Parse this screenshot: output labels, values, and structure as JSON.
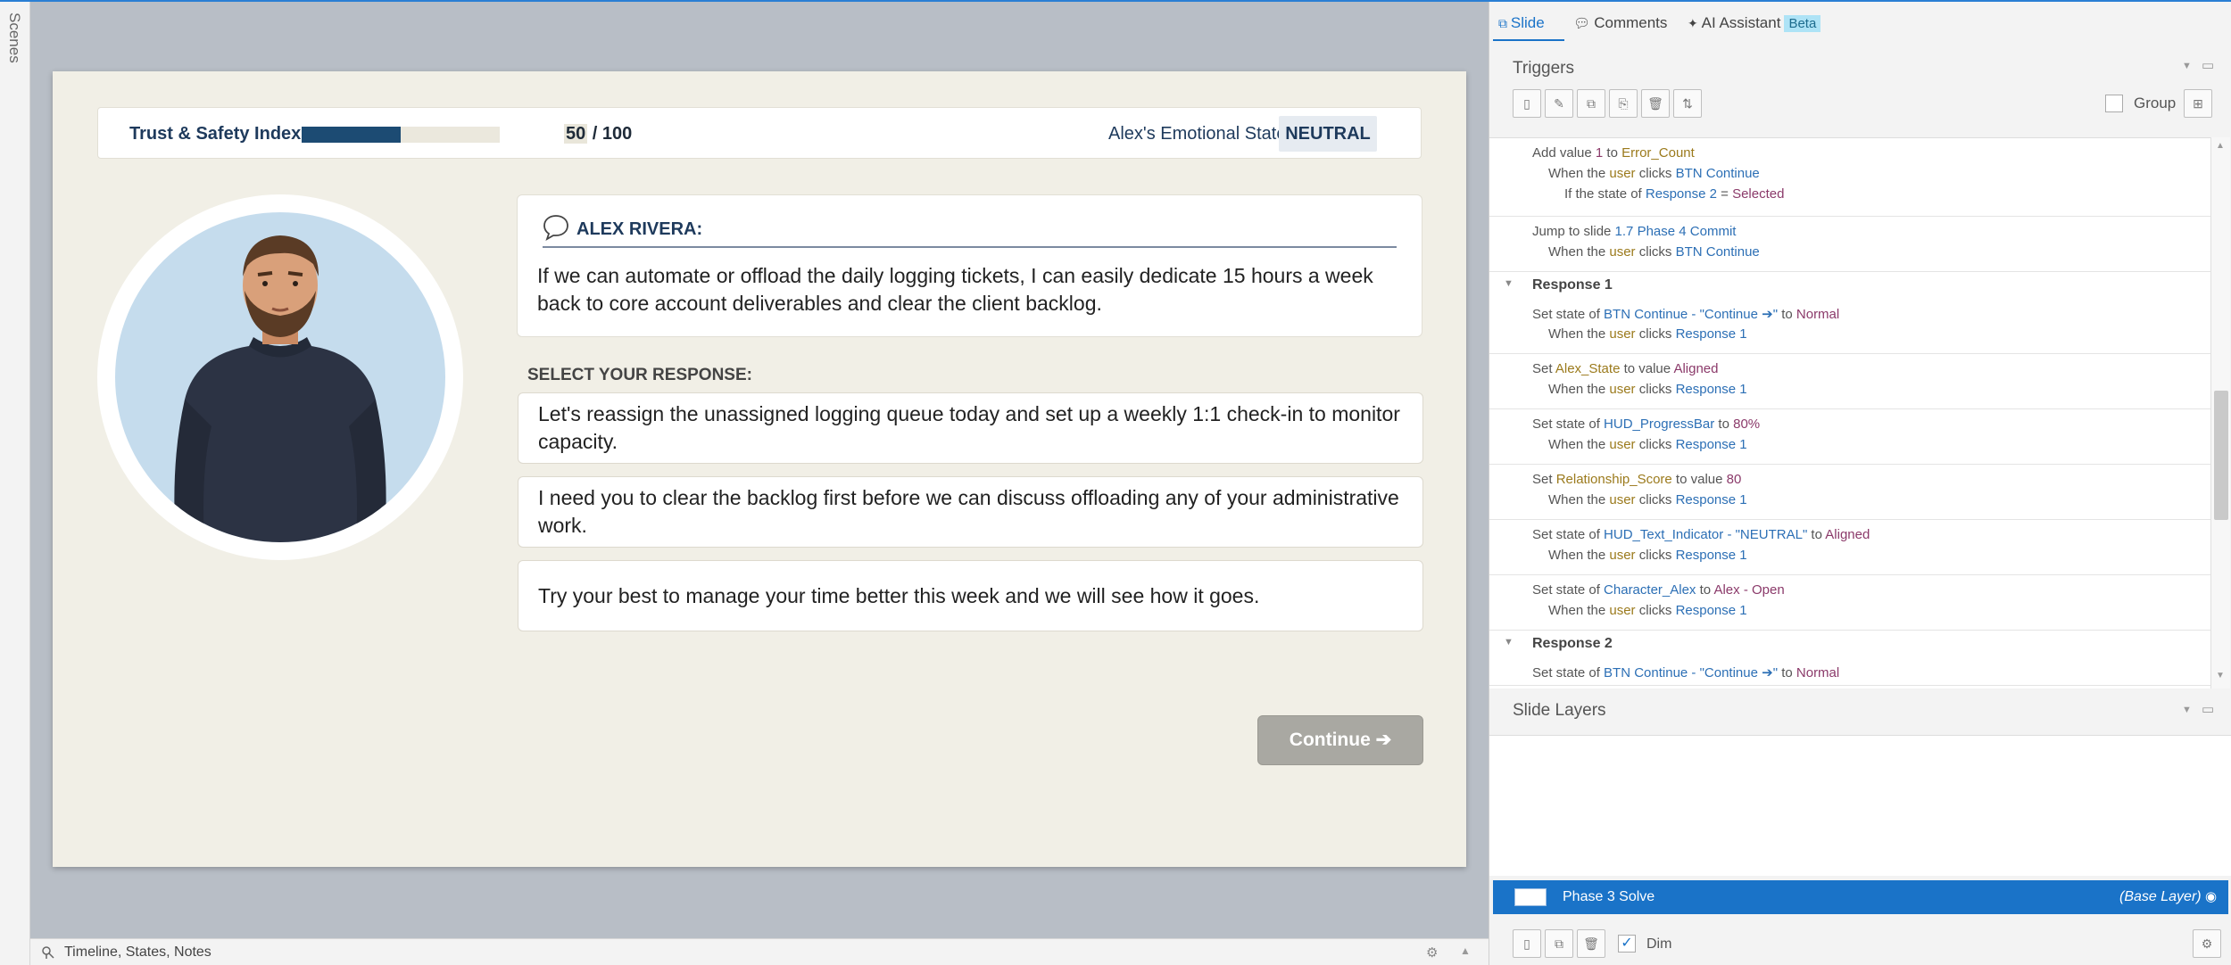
{
  "left_strip": {
    "label": "Scenes"
  },
  "hud": {
    "trust_label": "Trust & Safety Index:",
    "trust_progress_percent": 50,
    "score_value": "50",
    "score_suffix": " / 100",
    "emotion_label": "Alex's Emotional State:",
    "emotion_value": "NEUTRAL"
  },
  "speech": {
    "name": "ALEX RIVERA:",
    "text": "If we can automate or offload the daily logging tickets, I can easily dedicate 15 hours a week back to core account deliverables and clear the client backlog."
  },
  "select_label": "SELECT YOUR RESPONSE:",
  "responses": [
    "Let's reassign the unassigned logging queue today and set up a weekly 1:1 check-in to monitor capacity.",
    "I need you to clear the backlog first before we can discuss offloading any of your administrative work.",
    "Try your best to manage your time better this week and we will see how it goes."
  ],
  "continue_label": "Continue ➔",
  "bottom_bar": {
    "label": "Timeline, States, Notes"
  },
  "tabs": {
    "slide": "Slide",
    "comments": "Comments",
    "ai": "AI Assistant",
    "beta": "Beta"
  },
  "triggers_panel": {
    "title": "Triggers",
    "group_label": "Group",
    "rows": [
      {
        "parts": [
          [
            "Add value ",
            ""
          ],
          [
            "1",
            "p"
          ],
          [
            " to ",
            ""
          ],
          [
            "Error_Count",
            "v"
          ]
        ],
        "when": [
          [
            "When the ",
            ""
          ],
          [
            "user",
            "v"
          ],
          [
            " clicks ",
            ""
          ],
          [
            "BTN Continue",
            "u"
          ]
        ],
        "cond": [
          [
            "If the state of ",
            ""
          ],
          [
            "Response 2",
            "u"
          ],
          [
            " = ",
            ""
          ],
          [
            "Selected",
            "p"
          ]
        ]
      },
      {
        "parts": [
          [
            "Jump to slide ",
            ""
          ],
          [
            "1.7 Phase 4 Commit",
            "u"
          ]
        ],
        "when": [
          [
            "When the ",
            ""
          ],
          [
            "user",
            "v"
          ],
          [
            " clicks ",
            ""
          ],
          [
            "BTN Continue",
            "u"
          ]
        ]
      }
    ],
    "group1": "Response 1",
    "group1_rows": [
      {
        "parts": [
          [
            "Set state of ",
            ""
          ],
          [
            "BTN Continue  - \"Continue ➔\"",
            "u"
          ],
          [
            " to ",
            ""
          ],
          [
            "Normal",
            "p"
          ]
        ],
        "when": [
          [
            "When the ",
            ""
          ],
          [
            "user",
            "v"
          ],
          [
            " clicks ",
            ""
          ],
          [
            "Response 1",
            "u"
          ]
        ]
      },
      {
        "parts": [
          [
            "Set ",
            ""
          ],
          [
            "Alex_State",
            "v"
          ],
          [
            " to value ",
            ""
          ],
          [
            "Aligned",
            "p"
          ]
        ],
        "when": [
          [
            "When the ",
            ""
          ],
          [
            "user",
            "v"
          ],
          [
            " clicks ",
            ""
          ],
          [
            "Response 1",
            "u"
          ]
        ]
      },
      {
        "parts": [
          [
            "Set state of ",
            ""
          ],
          [
            "HUD_ProgressBar",
            "u"
          ],
          [
            " to ",
            ""
          ],
          [
            "80%",
            "p"
          ]
        ],
        "when": [
          [
            "When the ",
            ""
          ],
          [
            "user",
            "v"
          ],
          [
            " clicks ",
            ""
          ],
          [
            "Response 1",
            "u"
          ]
        ]
      },
      {
        "parts": [
          [
            "Set ",
            ""
          ],
          [
            "Relationship_Score",
            "v"
          ],
          [
            " to value ",
            ""
          ],
          [
            "80",
            "p"
          ]
        ],
        "when": [
          [
            "When the ",
            ""
          ],
          [
            "user",
            "v"
          ],
          [
            " clicks ",
            ""
          ],
          [
            "Response 1",
            "u"
          ]
        ]
      },
      {
        "parts": [
          [
            "Set state of ",
            ""
          ],
          [
            "HUD_Text_Indicator - \"NEUTRAL\"",
            "u"
          ],
          [
            " to ",
            ""
          ],
          [
            "Aligned",
            "p"
          ]
        ],
        "when": [
          [
            "When the ",
            ""
          ],
          [
            "user",
            "v"
          ],
          [
            " clicks ",
            ""
          ],
          [
            "Response 1",
            "u"
          ]
        ]
      },
      {
        "parts": [
          [
            "Set state of ",
            ""
          ],
          [
            "Character_Alex",
            "u"
          ],
          [
            " to ",
            ""
          ],
          [
            "Alex - Open",
            "p"
          ]
        ],
        "when": [
          [
            "When the ",
            ""
          ],
          [
            "user",
            "v"
          ],
          [
            " clicks ",
            ""
          ],
          [
            "Response 1",
            "u"
          ]
        ]
      }
    ],
    "group2": "Response 2",
    "group2_rows": [
      {
        "parts": [
          [
            "Set state of ",
            ""
          ],
          [
            "BTN Continue  - \"Continue ➔\"",
            "u"
          ],
          [
            " to ",
            ""
          ],
          [
            "Normal",
            "p"
          ]
        ]
      }
    ]
  },
  "layers_panel": {
    "title": "Slide Layers",
    "layer_name": "Phase 3 Solve",
    "layer_tag": "(Base Layer)",
    "dim_label": "Dim"
  },
  "colors": {
    "accent": "#1a73c8",
    "hud_fill": "#1c4b73",
    "slide_bg": "#f1efe6"
  }
}
